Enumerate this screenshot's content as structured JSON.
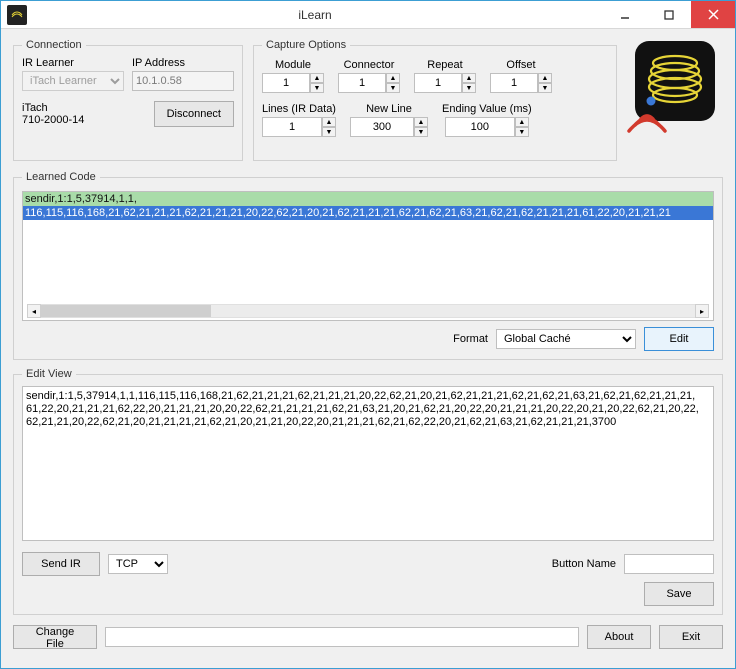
{
  "window": {
    "title": "iLearn"
  },
  "connection": {
    "legend": "Connection",
    "learnerLabel": "IR Learner",
    "learnerValue": "iTach Learner",
    "ipLabel": "IP Address",
    "ipValue": "10.1.0.58",
    "device": "iTach",
    "serial": "710-2000-14",
    "disconnect": "Disconnect"
  },
  "capture": {
    "legend": "Capture Options",
    "module": {
      "label": "Module",
      "value": "1"
    },
    "connector": {
      "label": "Connector",
      "value": "1"
    },
    "repeat": {
      "label": "Repeat",
      "value": "1"
    },
    "offset": {
      "label": "Offset",
      "value": "1"
    },
    "lines": {
      "label": "Lines (IR Data)",
      "value": "1"
    },
    "newline": {
      "label": "New Line",
      "value": "300"
    },
    "ending": {
      "label": "Ending Value (ms)",
      "value": "100"
    }
  },
  "learned": {
    "legend": "Learned Code",
    "line1": "sendir,1:1,5,37914,1,1,",
    "line2": "116,115,116,168,21,62,21,21,21,62,21,21,21,20,22,62,21,20,21,62,21,21,21,62,21,62,21,63,21,62,21,62,21,21,21,61,22,20,21,21,21",
    "formatLabel": "Format",
    "formatValue": "Global Caché",
    "editLabel": "Edit"
  },
  "editview": {
    "legend": "Edit View",
    "text": "sendir,1:1,5,37914,1,1,116,115,116,168,21,62,21,21,21,62,21,21,21,20,22,62,21,20,21,62,21,21,21,62,21,62,21,63,21,62,21,62,21,21,21,61,22,20,21,21,21,62,22,20,21,21,21,20,20,22,62,21,21,21,21,62,21,63,21,20,21,62,21,20,22,20,21,21,21,20,22,20,21,20,22,62,21,20,22,62,21,21,20,22,62,21,20,21,21,21,21,62,21,20,21,21,20,22,20,21,21,21,62,21,62,22,20,21,62,21,63,21,62,21,21,21,3700"
  },
  "sendRow": {
    "sendIr": "Send IR",
    "protoValue": "TCP",
    "buttonNameLabel": "Button Name",
    "buttonNameValue": "",
    "save": "Save"
  },
  "bottom": {
    "changeFile": "Change File",
    "fileValue": "",
    "about": "About",
    "exit": "Exit"
  }
}
